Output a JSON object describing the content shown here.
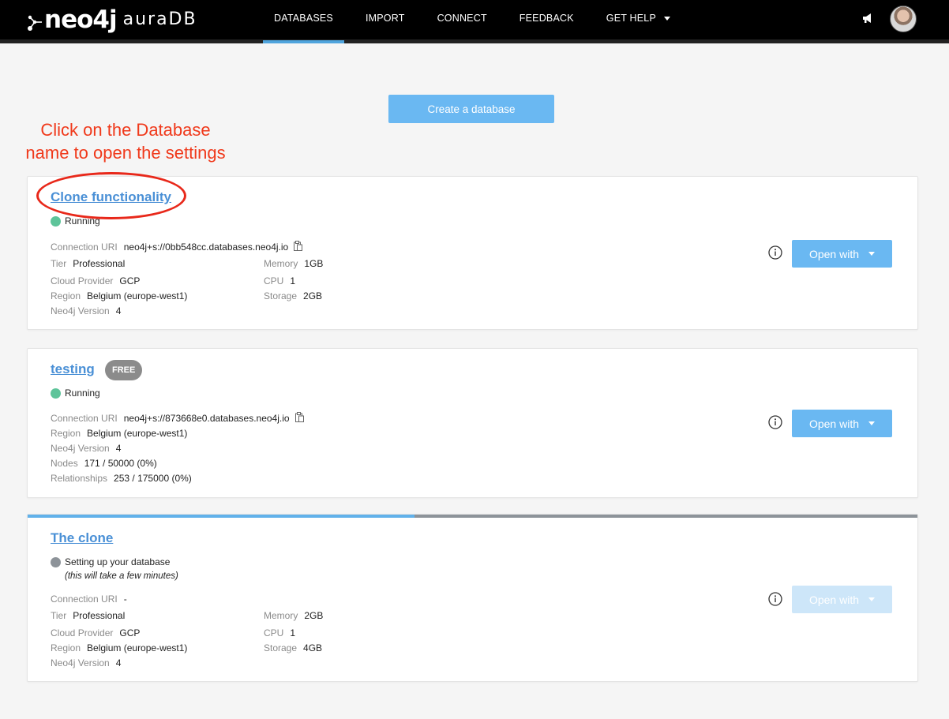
{
  "header": {
    "logo_main": "neo4j",
    "logo_sub": "auraDB",
    "nav": [
      {
        "label": "DATABASES",
        "active": true
      },
      {
        "label": "IMPORT"
      },
      {
        "label": "CONNECT"
      },
      {
        "label": "FEEDBACK"
      },
      {
        "label": "GET HELP"
      }
    ]
  },
  "create_button_label": "Create a database",
  "annotation": {
    "line1": "Click on the Database",
    "line2": "name to open the settings"
  },
  "databases": [
    {
      "name": "Clone functionality",
      "status": "Running",
      "fields": {
        "connection_uri": {
          "label": "Connection URI",
          "value": "neo4j+s://0bb548cc.databases.neo4j.io"
        },
        "tier": {
          "label": "Tier",
          "value": "Professional"
        },
        "memory": {
          "label": "Memory",
          "value": "1GB"
        },
        "cloud_provider": {
          "label": "Cloud Provider",
          "value": "GCP"
        },
        "cpu": {
          "label": "CPU",
          "value": "1"
        },
        "region": {
          "label": "Region",
          "value": "Belgium (europe-west1)"
        },
        "storage": {
          "label": "Storage",
          "value": "2GB"
        },
        "version": {
          "label": "Neo4j Version",
          "value": "4"
        }
      },
      "open_with_label": "Open with"
    },
    {
      "name": "testing",
      "badge": "FREE",
      "status": "Running",
      "fields": {
        "connection_uri": {
          "label": "Connection URI",
          "value": "neo4j+s://873668e0.databases.neo4j.io"
        },
        "region": {
          "label": "Region",
          "value": "Belgium (europe-west1)"
        },
        "version": {
          "label": "Neo4j Version",
          "value": "4"
        },
        "nodes": {
          "label": "Nodes",
          "value": "171 / 50000 (0%)"
        },
        "relationships": {
          "label": "Relationships",
          "value": "253 / 175000 (0%)"
        }
      },
      "open_with_label": "Open with"
    },
    {
      "name": "The clone",
      "status": "Setting up your database",
      "status_note": "(this will take a few minutes)",
      "setup_progress": 0.435,
      "fields": {
        "connection_uri": {
          "label": "Connection URI",
          "value": "-"
        },
        "tier": {
          "label": "Tier",
          "value": "Professional"
        },
        "memory": {
          "label": "Memory",
          "value": "2GB"
        },
        "cloud_provider": {
          "label": "Cloud Provider",
          "value": "GCP"
        },
        "cpu": {
          "label": "CPU",
          "value": "1"
        },
        "region": {
          "label": "Region",
          "value": "Belgium (europe-west1)"
        },
        "storage": {
          "label": "Storage",
          "value": "4GB"
        },
        "version": {
          "label": "Neo4j Version",
          "value": "4"
        }
      },
      "open_with_label": "Open with",
      "open_with_disabled": true
    }
  ],
  "colors": {
    "accent": "#6ab8f2",
    "link": "#4a90d6",
    "running": "#5ec49a",
    "pending": "#8d9399",
    "annotation": "#f0391b"
  }
}
